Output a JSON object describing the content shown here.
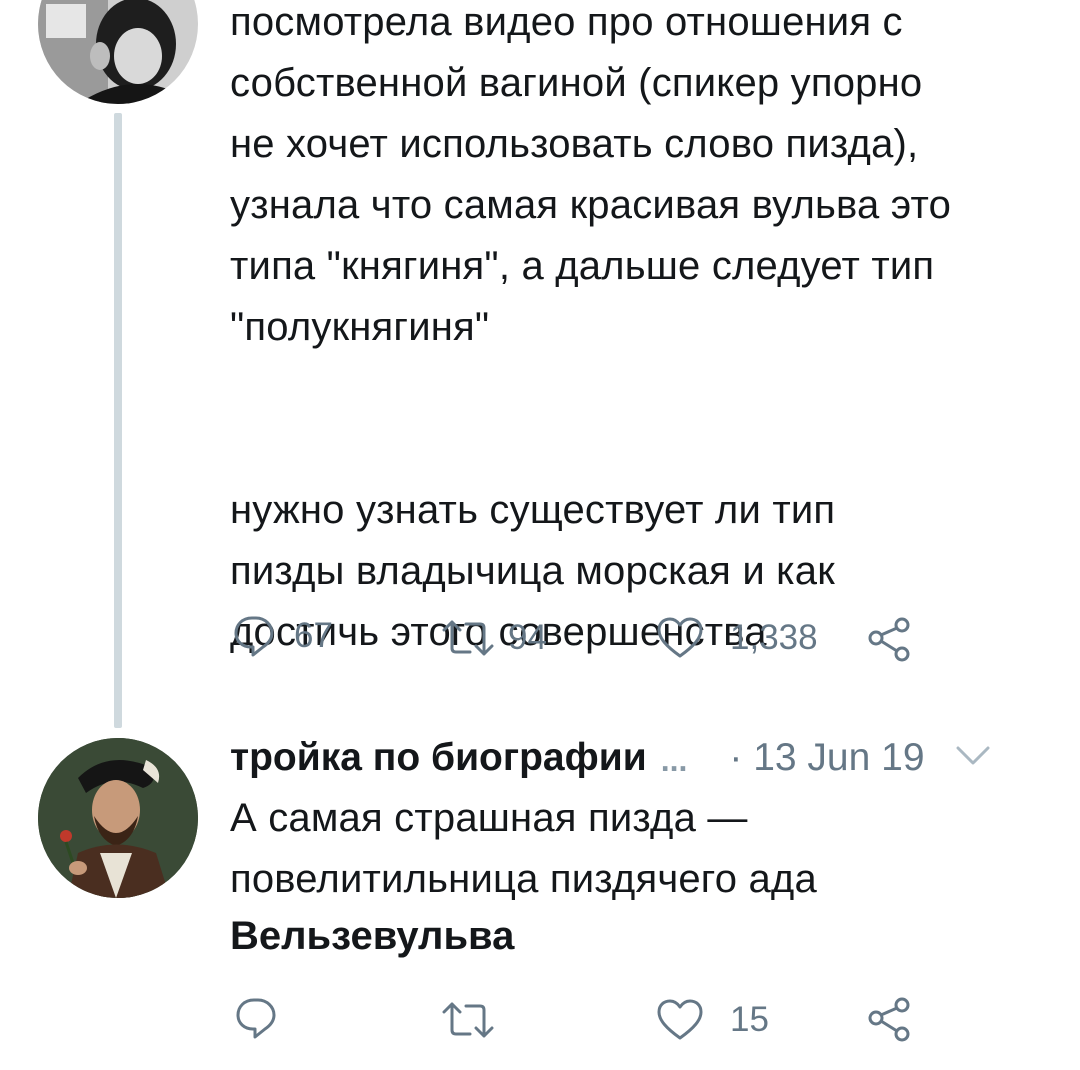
{
  "tweet1": {
    "text": "посмотрела видео про отношения с\nсобственной вагиной (спикер упорно\nне хочет использовать слово пизда),\nузнала что самая красивая вульва это\nтипа \"княгиня\", а дальше следует тип\n\"полукнягиня\"\n\n\nнужно узнать существует ли тип\nпизды владычица морская и как\nдостичь этого совершенства",
    "actions": {
      "replies": "67",
      "retweets": "94",
      "likes": "1,338"
    }
  },
  "tweet2": {
    "name": "тройка по биографии",
    "more": "...",
    "date": "· 13 Jun 19",
    "text": "А самая страшная пизда —\nповелитильница пиздячего ада",
    "bold_text": "Вельзевульва",
    "actions": {
      "replies": "",
      "retweets": "",
      "likes": "15"
    }
  },
  "colors": {
    "text": "#14171a",
    "secondary": "#657786",
    "thread_line": "#cfd9de"
  },
  "icons": [
    "reply-icon",
    "retweet-icon",
    "like-icon",
    "share-icon",
    "chevron-down-icon"
  ]
}
